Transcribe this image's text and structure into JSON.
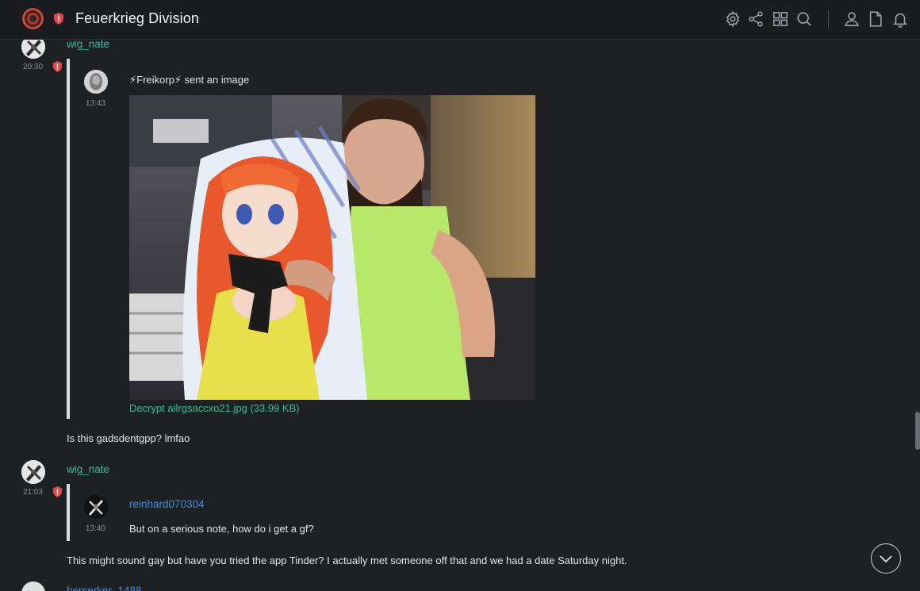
{
  "header": {
    "title": "Feuerkrieg Division",
    "icons": [
      "settings-icon",
      "share-icon",
      "grid-icon",
      "search-icon",
      "user-icon",
      "file-icon",
      "bell-icon"
    ]
  },
  "messages": [
    {
      "author": "wig_nate",
      "time": "20:30",
      "quote": {
        "author": "⚡Freikorp⚡",
        "action": "sent an image",
        "time": "13:43",
        "attachment": "Decrypt ailrgsaccxo21.jpg (33.99 KB)"
      },
      "text": "Is this gadsdentgpp? lmfao"
    },
    {
      "author": "wig_nate",
      "time": "21:03",
      "quote": {
        "author": "reinhard070304",
        "time": "13:40",
        "text": "But on a serious note, how do i get a gf?"
      },
      "text": "This might sound gay but have you tried the app Tinder? I actually met someone off that and we had a date Saturday night."
    }
  ],
  "next_author": "berserker_1488",
  "colors": {
    "background": "#1f2024",
    "username": "#2fbf9a",
    "username_alt": "#3d8fe0",
    "shield": "#e0474c"
  }
}
